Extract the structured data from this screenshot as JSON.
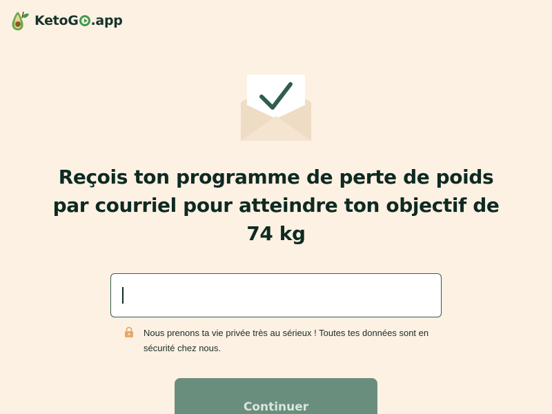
{
  "brand": {
    "name_prefix": "Keto",
    "name_g": "G",
    "name_suffix": ".app",
    "logo_icon": "avocado-icon",
    "accent_color": "#3e9a4f"
  },
  "envelope": {
    "icon": "envelope-check-icon",
    "check_color": "#2f5e4d"
  },
  "headline": "Reçois ton programme de perte de poids par courriel pour atteindre ton objectif de 74 kg",
  "email": {
    "value": "",
    "placeholder": ""
  },
  "privacy": {
    "icon": "lock-icon",
    "text": "Nous prenons ta vie privée très au sérieux ! Toutes tes données sont en sécurité chez nous."
  },
  "continue_button": {
    "label": "Continuer",
    "color": "#6a8e7e"
  },
  "colors": {
    "background": "#fdf1e3",
    "text": "#0e2a22"
  }
}
